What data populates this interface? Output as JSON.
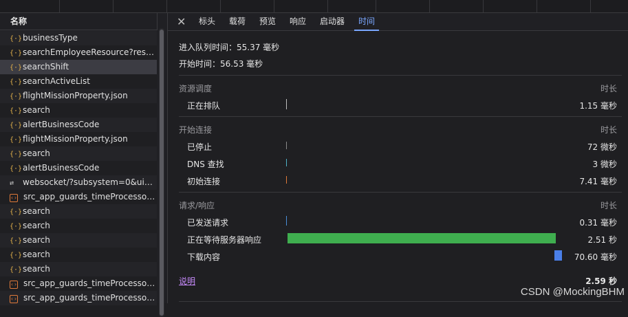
{
  "list": {
    "header": "名称",
    "items": [
      {
        "name": "businessType",
        "icon": "xhr-icon"
      },
      {
        "name": "searchEmployeeResource?reso...",
        "icon": "xhr-icon"
      },
      {
        "name": "searchShift",
        "icon": "xhr-icon",
        "selected": true
      },
      {
        "name": "searchActiveList",
        "icon": "xhr-icon"
      },
      {
        "name": "flightMissionProperty.json",
        "icon": "xhr-icon"
      },
      {
        "name": "search",
        "icon": "xhr-icon"
      },
      {
        "name": "alertBusinessCode",
        "icon": "xhr-icon"
      },
      {
        "name": "flightMissionProperty.json",
        "icon": "xhr-icon"
      },
      {
        "name": "search",
        "icon": "xhr-icon"
      },
      {
        "name": "alertBusinessCode",
        "icon": "xhr-icon"
      },
      {
        "name": "websocket/?subsystem=0&uid=...",
        "icon": "websocket-icon"
      },
      {
        "name": "src_app_guards_timeProcessor...",
        "icon": "script-icon"
      },
      {
        "name": "search",
        "icon": "xhr-icon"
      },
      {
        "name": "search",
        "icon": "xhr-icon"
      },
      {
        "name": "search",
        "icon": "xhr-icon"
      },
      {
        "name": "search",
        "icon": "xhr-icon"
      },
      {
        "name": "search",
        "icon": "xhr-icon"
      },
      {
        "name": "src_app_guards_timeProcessor...",
        "icon": "script-icon"
      },
      {
        "name": "src_app_guards_timeProcessor...",
        "icon": "script-icon"
      }
    ]
  },
  "tabs": {
    "items": [
      "标头",
      "载荷",
      "预览",
      "响应",
      "启动器",
      "时间"
    ],
    "active": "时间"
  },
  "timing": {
    "queued_at": "进入队列时间：55.37 毫秒",
    "started_at": "开始时间：56.53 毫秒",
    "duration_header": "时长",
    "sections": [
      {
        "title": "资源调度",
        "rows": [
          {
            "label": "正在排队",
            "value": "1.15 毫秒",
            "fraction": 0.002,
            "color": "#bfbfbf"
          }
        ]
      },
      {
        "title": "开始连接",
        "rows": [
          {
            "label": "已停止",
            "value": "72 微秒",
            "fraction": 0.001,
            "color": "#8a8a8a"
          },
          {
            "label": "DNS 查找",
            "value": "3 微秒",
            "fraction": 0.001,
            "color": "#4fb3c9"
          },
          {
            "label": "初始连接",
            "value": "7.41 毫秒",
            "fraction": 0.001,
            "color": "#e07a3a"
          }
        ]
      },
      {
        "title": "请求/响应",
        "rows": [
          {
            "label": "已发送请求",
            "value": "0.31 毫秒",
            "fraction": 0.001,
            "color": "#4a8fd9"
          },
          {
            "label": "正在等待服务器响应",
            "value": "2.51 秒",
            "fraction": 0.97,
            "color": "#3fae4f"
          },
          {
            "label": "下载内容",
            "value": "70.60 毫秒",
            "fraction": 0.027,
            "color": "#4a7fe8"
          }
        ]
      }
    ],
    "explanation_link": "说明",
    "total": "2.59 秒"
  },
  "watermark": "CSDN @MockingBHM",
  "colors": {
    "accent": "#7aa7ff",
    "link": "#c58af9",
    "waiting": "#3fae4f",
    "download": "#4a7fe8"
  }
}
